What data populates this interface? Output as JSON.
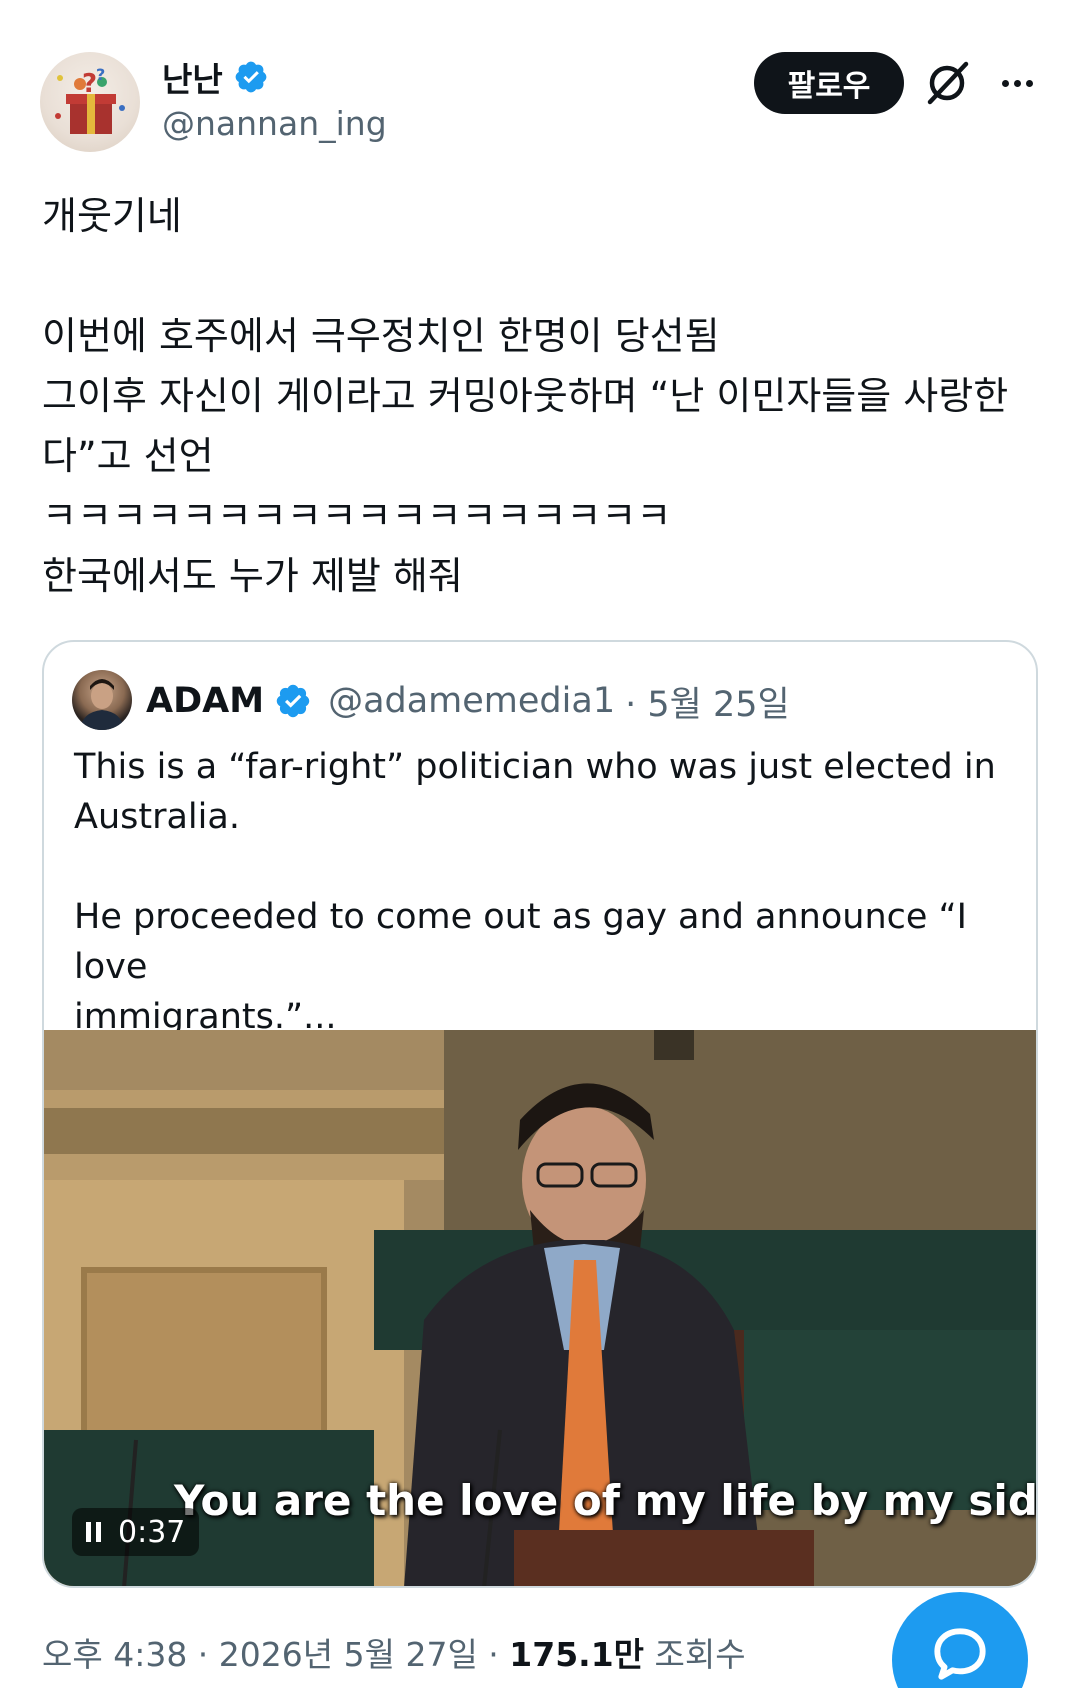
{
  "author": {
    "display_name": "난난",
    "handle": "@nannan_ing",
    "verified_color": "#1d9bf0"
  },
  "actions": {
    "follow_label": "팔로우",
    "grok_icon": "grok-icon",
    "more_icon": "more-icon"
  },
  "tweet": {
    "text": "개웃기네\n\n이번에 호주에서 극우정치인 한명이 당선됨\n그이후 자신이 게이라고 커밍아웃하며 “난 이민자들을 사랑한\n다”고 선언\nㅋㅋㅋㅋㅋㅋㅋㅋㅋㅋㅋㅋㅋㅋㅋㅋㅋㅋ\n한국에서도 누가 제발 해줘"
  },
  "quote": {
    "display_name": "ADAM",
    "handle": "@adamemedia1",
    "date": "· 5월 25일",
    "text": "This is a “far-right” politician who was just elected in\nAustralia.\n\nHe proceeded to come out as gay and announce “I love\nimmigrants.”...",
    "video": {
      "caption": "You are the love of my life by my side",
      "duration": "0:37",
      "state_icon": "pause-icon"
    }
  },
  "meta": {
    "time": "오후 4:38 · 2026년 5월 27일 · ",
    "views_count": "175.1만",
    "views_label": " 조회수"
  },
  "fab": {
    "icon": "reply-icon",
    "color": "#1d9bf0"
  }
}
